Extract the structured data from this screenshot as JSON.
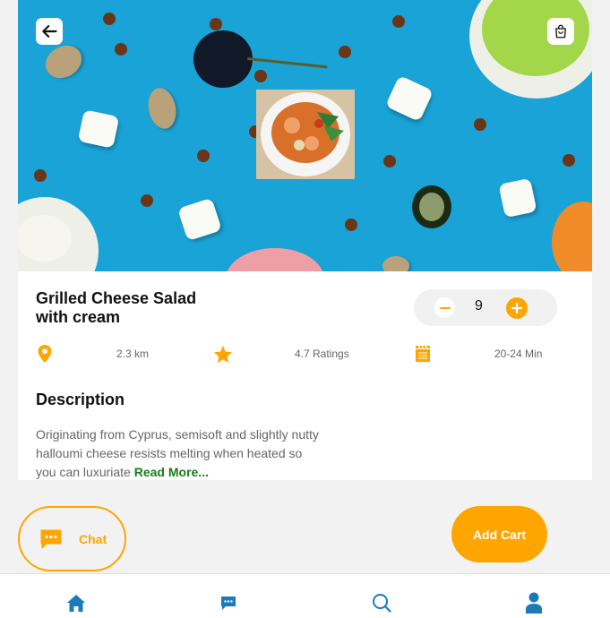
{
  "product": {
    "title_line1": "Grilled Cheese Salad",
    "title_line2": "with cream",
    "quantity": "9"
  },
  "meta": {
    "distance": "2.3 km",
    "ratings": "4.7 Ratings",
    "time": "20-24 Min"
  },
  "description": {
    "heading": "Description",
    "text": "Originating from Cyprus, semisoft and slightly nutty halloumi cheese resists melting when heated so you can luxuriate",
    "read_more": "Read More..."
  },
  "actions": {
    "chat_label": "Chat",
    "add_cart_label": "Add Cart"
  },
  "icons": {
    "back": "back-arrow-icon",
    "bag": "shopping-bag-icon",
    "location": "location-pin-icon",
    "rating": "star-icon",
    "time": "film-clapper-icon",
    "chat": "chat-bubble-icon",
    "nav": [
      "home-icon",
      "message-icon",
      "search-icon",
      "profile-icon"
    ]
  },
  "colors": {
    "accent": "#ffa500",
    "nav_active": "#1a7bb8",
    "link": "#1a7a1a",
    "hero_background": "#1aa3d6"
  }
}
